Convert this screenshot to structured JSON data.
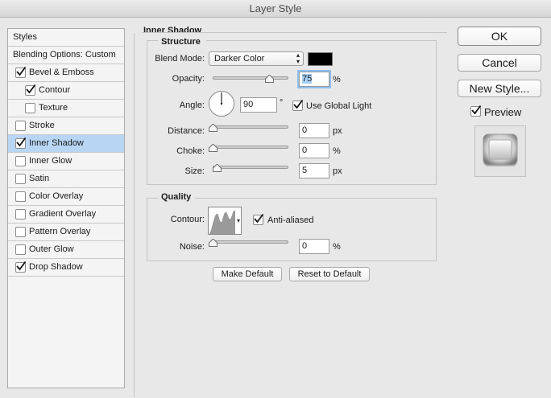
{
  "window": {
    "title": "Layer Style"
  },
  "styles_panel": {
    "header": "Styles",
    "blending_options": "Blending Options: Custom",
    "items": [
      {
        "label": "Bevel & Emboss",
        "checked": true
      },
      {
        "label": "Contour",
        "checked": true
      },
      {
        "label": "Texture",
        "checked": false
      },
      {
        "label": "Stroke",
        "checked": false
      },
      {
        "label": "Inner Shadow",
        "checked": true,
        "selected": true
      },
      {
        "label": "Inner Glow",
        "checked": false
      },
      {
        "label": "Satin",
        "checked": false
      },
      {
        "label": "Color Overlay",
        "checked": false
      },
      {
        "label": "Gradient Overlay",
        "checked": false
      },
      {
        "label": "Pattern Overlay",
        "checked": false
      },
      {
        "label": "Outer Glow",
        "checked": false
      },
      {
        "label": "Drop Shadow",
        "checked": true
      }
    ]
  },
  "inner_shadow": {
    "title": "Inner Shadow",
    "structure": {
      "title": "Structure",
      "blend_mode_label": "Blend Mode:",
      "blend_mode_value": "Darker Color",
      "shadow_color": "#000000",
      "opacity_label": "Opacity:",
      "opacity_value": "75",
      "opacity_unit": "%",
      "opacity_level": 0.75,
      "angle_label": "Angle:",
      "angle_value": "90",
      "angle_unit": "°",
      "use_global_light_label": "Use Global Light",
      "use_global_light_checked": true,
      "distance_label": "Distance:",
      "distance_value": "0",
      "distance_unit": "px",
      "choke_label": "Choke:",
      "choke_value": "0",
      "choke_unit": "%",
      "size_label": "Size:",
      "size_value": "5",
      "size_unit": "px"
    },
    "quality": {
      "title": "Quality",
      "contour_label": "Contour:",
      "anti_aliased_label": "Anti-aliased",
      "anti_aliased_checked": true,
      "noise_label": "Noise:",
      "noise_value": "0",
      "noise_unit": "%"
    },
    "make_default_label": "Make Default",
    "reset_default_label": "Reset to Default"
  },
  "actions": {
    "ok_label": "OK",
    "cancel_label": "Cancel",
    "new_style_label": "New Style...",
    "preview_label": "Preview",
    "preview_checked": true
  },
  "colors": {
    "selection": "#b8d6f4",
    "text_highlight": "#9ccaf5"
  }
}
